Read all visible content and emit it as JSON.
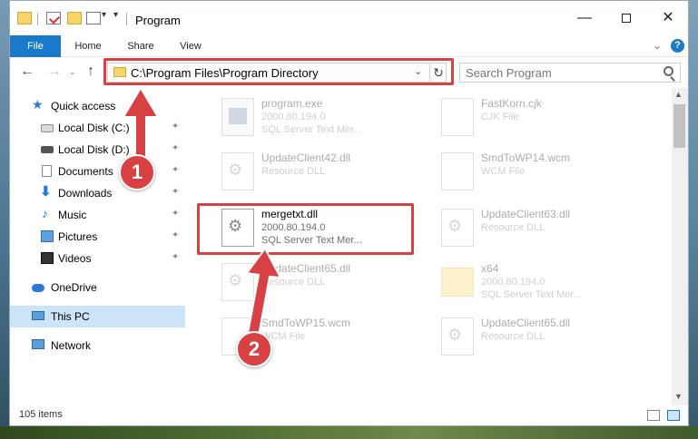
{
  "window": {
    "title": "Program",
    "minimize": "—",
    "close": "✕"
  },
  "ribbon": {
    "file": "File",
    "home": "Home",
    "share": "Share",
    "view": "View",
    "help": "?"
  },
  "address": {
    "path": "C:\\Program Files\\Program Directory",
    "dropdown": "⌄",
    "refresh": "↻"
  },
  "search": {
    "placeholder": "Search Program"
  },
  "nav": {
    "back": "←",
    "forward": "→",
    "recent": "⌄",
    "up": "↑"
  },
  "sidebar": {
    "items": [
      {
        "label": "Quick access",
        "icon": "star-icon",
        "pinned": false
      },
      {
        "label": "Local Disk (C:)",
        "icon": "drive-icon",
        "pinned": true
      },
      {
        "label": "Local Disk (D:)",
        "icon": "drive-icon",
        "pinned": true
      },
      {
        "label": "Documents",
        "icon": "documents-icon",
        "pinned": true
      },
      {
        "label": "Downloads",
        "icon": "downloads-icon",
        "pinned": true
      },
      {
        "label": "Music",
        "icon": "music-icon",
        "pinned": true
      },
      {
        "label": "Pictures",
        "icon": "pictures-icon",
        "pinned": true
      },
      {
        "label": "Videos",
        "icon": "videos-icon",
        "pinned": true
      },
      {
        "label": "OneDrive",
        "icon": "onedrive-icon",
        "pinned": false
      },
      {
        "label": "This PC",
        "icon": "pc-icon",
        "pinned": false,
        "selected": true
      },
      {
        "label": "Network",
        "icon": "network-icon",
        "pinned": false
      }
    ],
    "pin_glyph": "📌"
  },
  "files": [
    {
      "name": "program.exe",
      "line1": "2000.80.194.0",
      "line2": "SQL Server Text Mer...",
      "icon": "exe-icon",
      "faded": true
    },
    {
      "name": "FastKorn.cjk",
      "line1": "CJK File",
      "line2": "",
      "icon": "file-icon",
      "faded": true
    },
    {
      "name": "UpdateClient42.dll",
      "line1": "Resource DLL",
      "line2": "",
      "icon": "dll-icon",
      "faded": true
    },
    {
      "name": "SmdToWP14.wcm",
      "line1": "WCM File",
      "line2": "",
      "icon": "file-icon",
      "faded": true
    },
    {
      "name": "mergetxt.dll",
      "line1": "2000.80.194.0",
      "line2": "SQL Server Text Mer...",
      "icon": "dll-icon",
      "faded": false
    },
    {
      "name": "UpdateClient63.dll",
      "line1": "Resource DLL",
      "line2": "",
      "icon": "dll-icon",
      "faded": true
    },
    {
      "name": "UpdateClient65.dll",
      "line1": "Resource DLL",
      "line2": "",
      "icon": "dll-icon",
      "faded": true
    },
    {
      "name": "x64",
      "line1": "2000.80.194.0",
      "line2": "SQL Server Text Mer...",
      "icon": "folder-icon",
      "faded": true
    },
    {
      "name": "SmdToWP15.wcm",
      "line1": "WCM File",
      "line2": "",
      "icon": "file-icon",
      "faded": true
    },
    {
      "name": "UpdateClient65.dll",
      "line1": "Resource DLL",
      "line2": "",
      "icon": "dll-icon",
      "faded": true
    }
  ],
  "status": {
    "count": "105 items"
  },
  "annotations": {
    "step1": "1",
    "step2": "2",
    "color": "#d84143"
  },
  "colors": {
    "accent": "#1979ca",
    "selected_bg": "#cce4f7",
    "highlight": "#d84143"
  }
}
